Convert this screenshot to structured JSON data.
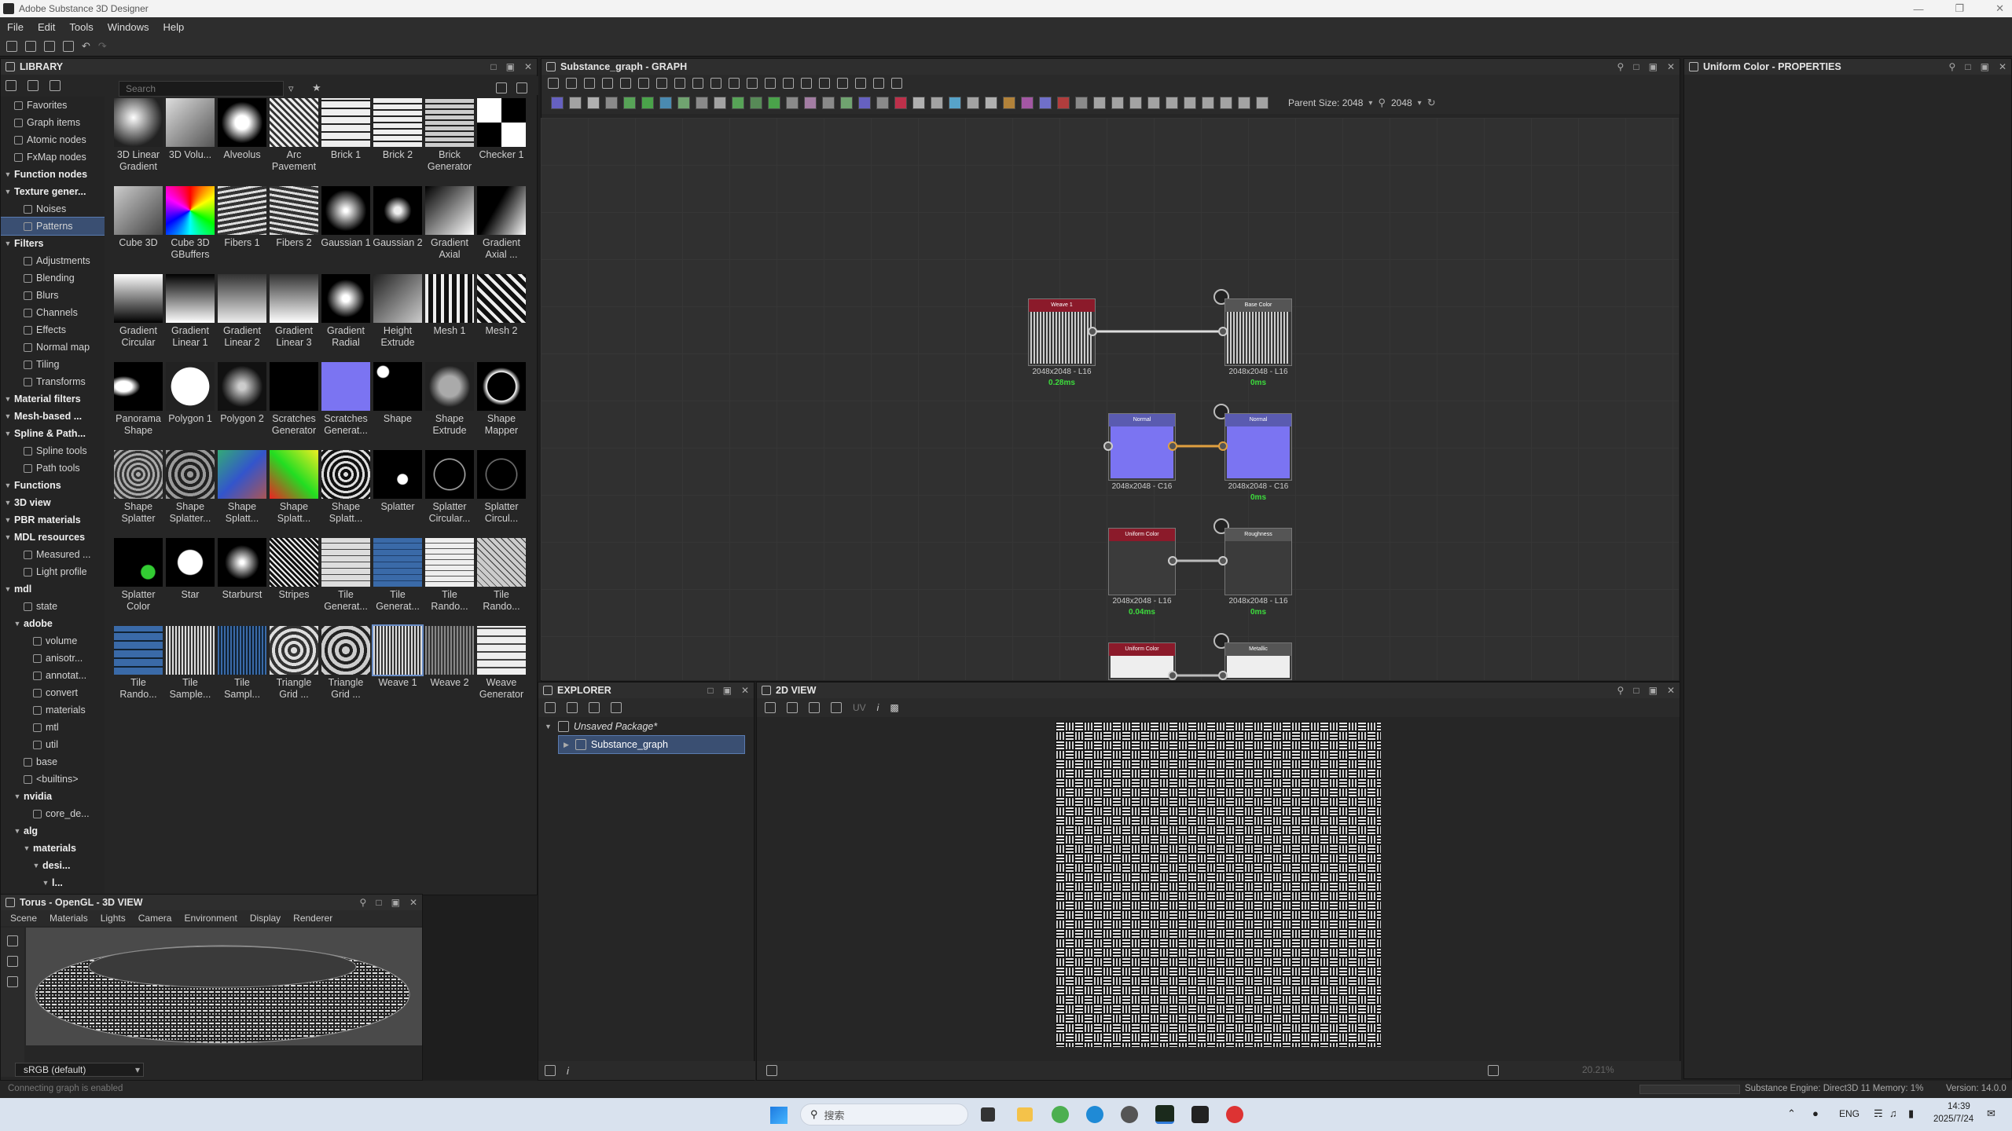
{
  "app": {
    "title": "Adobe Substance 3D Designer",
    "menu": [
      "File",
      "Edit",
      "Tools",
      "Windows",
      "Help"
    ]
  },
  "library": {
    "title": "LIBRARY",
    "search_placeholder": "Search",
    "tree": [
      {
        "label": "Favorites",
        "bold": false,
        "indent": 0
      },
      {
        "label": "Graph items",
        "bold": false,
        "indent": 0
      },
      {
        "label": "Atomic nodes",
        "bold": false,
        "indent": 0
      },
      {
        "label": "FxMap nodes",
        "bold": false,
        "indent": 0
      },
      {
        "label": "Function nodes",
        "bold": true,
        "indent": 0
      },
      {
        "label": "Texture gener...",
        "bold": true,
        "indent": 0
      },
      {
        "label": "Noises",
        "bold": false,
        "indent": 1
      },
      {
        "label": "Patterns",
        "bold": false,
        "indent": 1,
        "selected": true
      },
      {
        "label": "Filters",
        "bold": true,
        "indent": 0
      },
      {
        "label": "Adjustments",
        "bold": false,
        "indent": 1
      },
      {
        "label": "Blending",
        "bold": false,
        "indent": 1
      },
      {
        "label": "Blurs",
        "bold": false,
        "indent": 1
      },
      {
        "label": "Channels",
        "bold": false,
        "indent": 1
      },
      {
        "label": "Effects",
        "bold": false,
        "indent": 1
      },
      {
        "label": "Normal map",
        "bold": false,
        "indent": 1
      },
      {
        "label": "Tiling",
        "bold": false,
        "indent": 1
      },
      {
        "label": "Transforms",
        "bold": false,
        "indent": 1
      },
      {
        "label": "Material filters",
        "bold": true,
        "indent": 0
      },
      {
        "label": "Mesh-based ...",
        "bold": true,
        "indent": 0
      },
      {
        "label": "Spline & Path...",
        "bold": true,
        "indent": 0
      },
      {
        "label": "Spline tools",
        "bold": false,
        "indent": 1
      },
      {
        "label": "Path tools",
        "bold": false,
        "indent": 1
      },
      {
        "label": "Functions",
        "bold": true,
        "indent": 0
      },
      {
        "label": "3D view",
        "bold": true,
        "indent": 0
      },
      {
        "label": "PBR materials",
        "bold": true,
        "indent": 0
      },
      {
        "label": "MDL resources",
        "bold": true,
        "indent": 0
      },
      {
        "label": "Measured ...",
        "bold": false,
        "indent": 1
      },
      {
        "label": "Light profile",
        "bold": false,
        "indent": 1
      },
      {
        "label": "mdl",
        "bold": true,
        "indent": 0
      },
      {
        "label": "state",
        "bold": false,
        "indent": 1
      },
      {
        "label": "adobe",
        "bold": true,
        "indent": 1
      },
      {
        "label": "volume",
        "bold": false,
        "indent": 2
      },
      {
        "label": "anisotr...",
        "bold": false,
        "indent": 2
      },
      {
        "label": "annotat...",
        "bold": false,
        "indent": 2
      },
      {
        "label": "convert",
        "bold": false,
        "indent": 2
      },
      {
        "label": "materials",
        "bold": false,
        "indent": 2
      },
      {
        "label": "mtl",
        "bold": false,
        "indent": 2
      },
      {
        "label": "util",
        "bold": false,
        "indent": 2
      },
      {
        "label": "base",
        "bold": false,
        "indent": 1
      },
      {
        "label": "<builtins>",
        "bold": false,
        "indent": 1
      },
      {
        "label": "nvidia",
        "bold": true,
        "indent": 1
      },
      {
        "label": "core_de...",
        "bold": false,
        "indent": 2
      },
      {
        "label": "alg",
        "bold": true,
        "indent": 1
      },
      {
        "label": "materials",
        "bold": true,
        "indent": 2
      },
      {
        "label": "desi...",
        "bold": true,
        "indent": 3
      },
      {
        "label": "l...",
        "bold": true,
        "indent": 4
      }
    ],
    "items": [
      "3D Linear Gradient",
      "3D Volu...",
      "Alveolus",
      "Arc Pavement",
      "Brick 1",
      "Brick 2",
      "Brick Generator",
      "Checker 1",
      "Cube 3D",
      "Cube 3D GBuffers",
      "Fibers 1",
      "Fibers 2",
      "Gaussian 1",
      "Gaussian 2",
      "Gradient Axial",
      "Gradient Axial ...",
      "Gradient Circular",
      "Gradient Linear 1",
      "Gradient Linear 2",
      "Gradient Linear 3",
      "Gradient Radial",
      "Height Extrude",
      "Mesh 1",
      "Mesh 2",
      "Panorama Shape",
      "Polygon 1",
      "Polygon 2",
      "Scratches Generator",
      "Scratches Generat...",
      "Shape",
      "Shape Extrude",
      "Shape Mapper",
      "Shape Splatter",
      "Shape Splatter...",
      "Shape Splatt...",
      "Shape Splatt...",
      "Shape Splatt...",
      "Splatter",
      "Splatter Circular...",
      "Splatter Circul...",
      "Splatter Color",
      "Star",
      "Starburst",
      "Stripes",
      "Tile Generat...",
      "Tile Generat...",
      "Tile Rando...",
      "Tile Rando...",
      "Tile Rando...",
      "Tile Sample...",
      "Tile Sampl...",
      "Triangle Grid ...",
      "Triangle Grid ...",
      "Weave 1",
      "Weave 2",
      "Weave Generator"
    ],
    "selected_item": "Weave 1"
  },
  "graph": {
    "title": "Substance_graph - GRAPH",
    "parent_size_label": "Parent Size: 2048",
    "size_value": "2048",
    "nodes": [
      {
        "id": "weave",
        "header": "Weave 1",
        "info": "2048x2048 - L16",
        "time": "0.28ms"
      },
      {
        "id": "basecolor",
        "header": "Base Color",
        "info": "2048x2048 - L16",
        "time": "0ms"
      },
      {
        "id": "normal",
        "header": "Normal",
        "info": "2048x2048 - C16",
        "time": ""
      },
      {
        "id": "normalout",
        "header": "Normal",
        "info": "2048x2048 - C16",
        "time": "0ms"
      },
      {
        "id": "uniform1",
        "header": "Uniform Color",
        "info": "2048x2048 - L16",
        "time": "0.04ms"
      },
      {
        "id": "roughness",
        "header": "Roughness",
        "info": "2048x2048 - L16",
        "time": "0ms"
      },
      {
        "id": "uniform2",
        "header": "Uniform Color",
        "info": "",
        "time": ""
      },
      {
        "id": "metallic",
        "header": "Metallic",
        "info": "",
        "time": ""
      }
    ]
  },
  "properties": {
    "title": "Uniform Color - PROPERTIES"
  },
  "explorer": {
    "title": "EXPLORER",
    "package": "Unsaved Package*",
    "graph_item": "Substance_graph"
  },
  "view2d": {
    "title": "2D VIEW",
    "uv_label": "UV",
    "zoom": "20.21%"
  },
  "view3d": {
    "title": "Torus - OpenGL - 3D VIEW",
    "menu": [
      "Scene",
      "Materials",
      "Lights",
      "Camera",
      "Environment",
      "Display",
      "Renderer"
    ],
    "colorspace": "sRGB (default)"
  },
  "statusbar": {
    "left": "Connecting graph is enabled",
    "engine": "Substance Engine: Direct3D 11  Memory: 1%",
    "version": "Version: 14.0.0"
  },
  "taskbar": {
    "search": "搜索",
    "lang": "ENG",
    "time": "14:39",
    "date": "2025/7/24"
  },
  "colors": {
    "accent": "#6a8ec7",
    "node_red_header": "#8b1a2a",
    "node_purple": "#7b74f2",
    "timing_green": "#3ddc3d",
    "orange_link": "#e0a040"
  }
}
